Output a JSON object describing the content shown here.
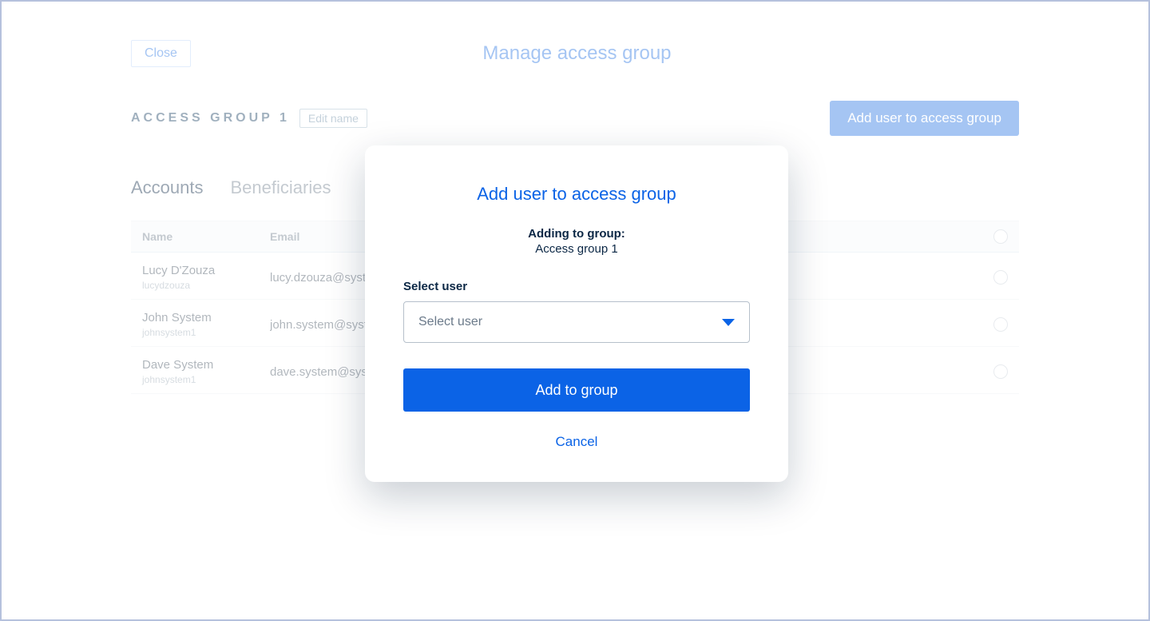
{
  "header": {
    "close_label": "Close",
    "page_title": "Manage access group"
  },
  "group": {
    "name": "ACCESS GROUP 1",
    "edit_name_label": "Edit name",
    "add_user_label": "Add user to access group"
  },
  "tabs": {
    "accounts": "Accounts",
    "beneficiaries": "Beneficiaries"
  },
  "table": {
    "columns": {
      "name": "Name",
      "email": "Email"
    },
    "rows": [
      {
        "name": "Lucy D'Zouza",
        "username": "lucydzouza",
        "email": "lucy.dzouza@syste"
      },
      {
        "name": "John System",
        "username": "johnsystem1",
        "email": "john.system@syste"
      },
      {
        "name": "Dave System",
        "username": "johnsystem1",
        "email": "dave.system@syste"
      }
    ]
  },
  "modal": {
    "title": "Add user to access group",
    "adding_to_label": "Adding to group:",
    "group_name": "Access group 1",
    "select_user_label": "Select user",
    "select_placeholder": "Select user",
    "submit_label": "Add to group",
    "cancel_label": "Cancel"
  }
}
